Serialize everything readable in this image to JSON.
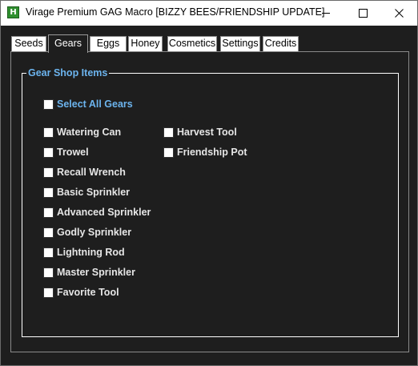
{
  "window": {
    "title": "Virage Premium GAG Macro [BIZZY BEES/FRIENDSHIP UPDATE]",
    "icon_letter": "H"
  },
  "tabs": [
    {
      "label": "Seeds"
    },
    {
      "label": "Gears"
    },
    {
      "label": "Eggs"
    },
    {
      "label": "Honey"
    },
    {
      "label": "Cosmetics"
    },
    {
      "label": "Settings"
    },
    {
      "label": "Credits"
    }
  ],
  "active_tab": "Gears",
  "gear_shop": {
    "group_label": "Gear Shop Items",
    "select_all": {
      "label": "Select All Gears",
      "checked": false
    },
    "items": [
      {
        "label": "Watering Can",
        "checked": false
      },
      {
        "label": "Trowel",
        "checked": false
      },
      {
        "label": "Recall Wrench",
        "checked": false
      },
      {
        "label": "Basic Sprinkler",
        "checked": false
      },
      {
        "label": "Advanced Sprinkler",
        "checked": false
      },
      {
        "label": "Godly Sprinkler",
        "checked": false
      },
      {
        "label": "Lightning Rod",
        "checked": false
      },
      {
        "label": "Master Sprinkler",
        "checked": false
      },
      {
        "label": "Favorite Tool",
        "checked": false
      },
      {
        "label": "Harvest Tool",
        "checked": false
      },
      {
        "label": "Friendship Pot",
        "checked": false
      }
    ]
  },
  "colors": {
    "accent": "#6cb4ee",
    "background": "#1e1e1e",
    "text": "#e6e6e6"
  }
}
